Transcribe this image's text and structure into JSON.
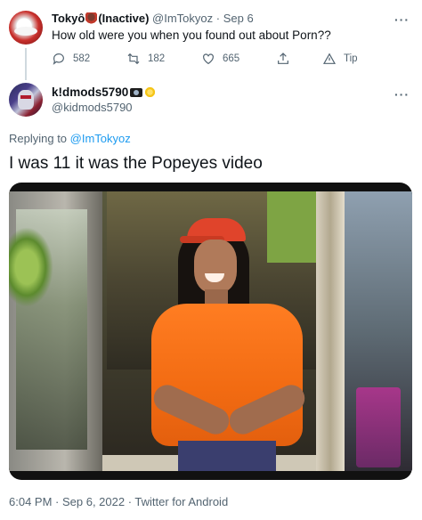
{
  "parent_tweet": {
    "display_name": "Tokyô",
    "inactive_label": "(Inactive)",
    "handle": "@ImTokyoz",
    "dot": "·",
    "date": "Sep 6",
    "text": "How old were you when you found out about Porn??",
    "replies": "582",
    "retweets": "182",
    "likes": "665",
    "tip_label": "Tip",
    "more": "···"
  },
  "reply_tweet": {
    "display_name": "k!dmods5790",
    "handle": "@kidmods5790",
    "more": "···",
    "replying_prefix": "Replying to",
    "replying_handle": "@ImTokyoz",
    "text": "I was 11 it was the Popeyes video",
    "timestamp": "6:04 PM · Sep 6, 2022 · Twitter for Android"
  },
  "colors": {
    "text_primary": "#0f1419",
    "text_secondary": "#536471",
    "link_blue": "#1d9bf0",
    "thread_line": "#cfd9de",
    "shirt_orange": "#f26b12"
  },
  "icons": {
    "reply": "speech-bubble-icon",
    "retweet": "retweet-icon",
    "like": "heart-icon",
    "share": "share-icon",
    "tip": "tip-icon",
    "more": "more-dots-icon"
  }
}
